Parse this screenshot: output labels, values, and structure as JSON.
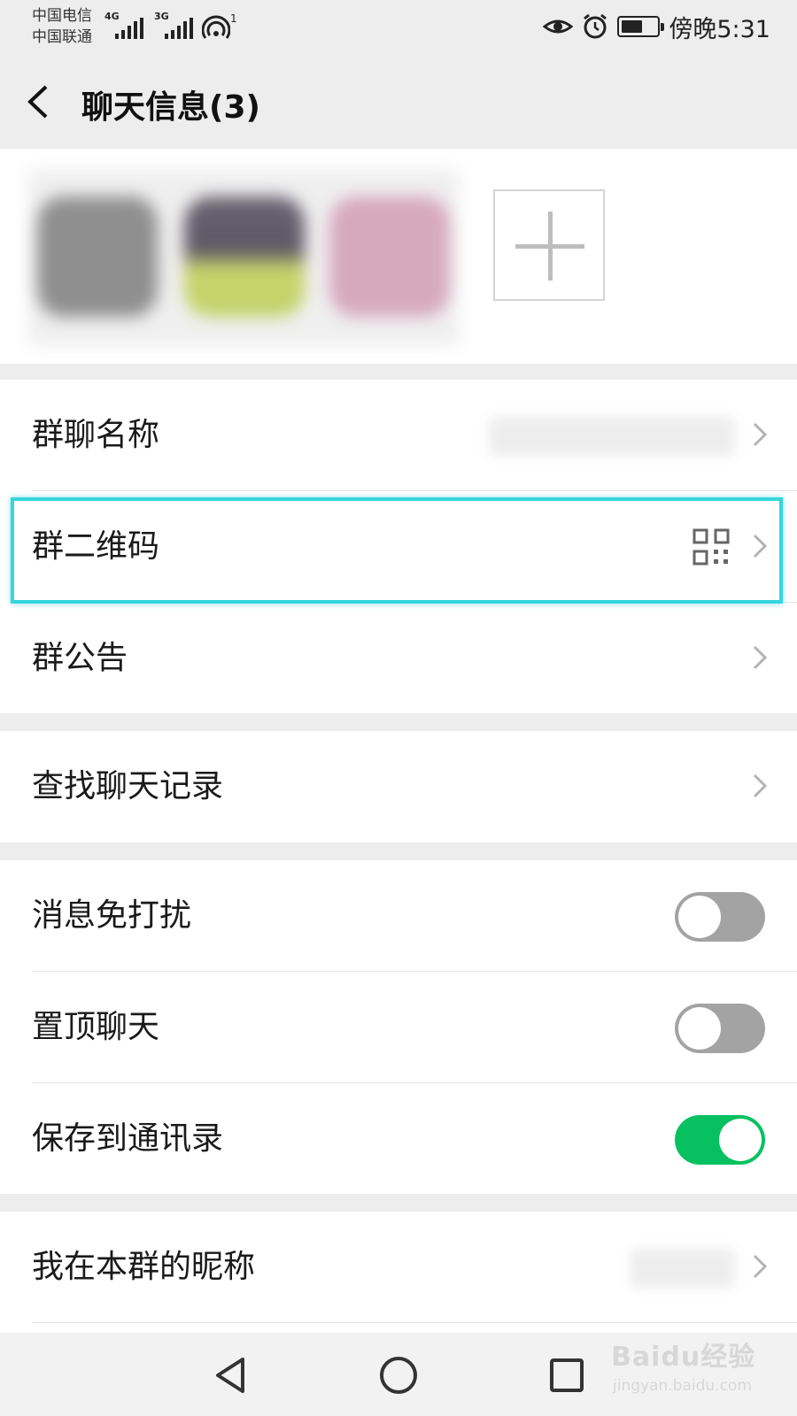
{
  "status_bar": {
    "carrier_1": "中国电信",
    "carrier_2": "中国联通",
    "signal_1_type": "4G",
    "signal_2_type": "3G",
    "hotspot_count": "1",
    "time": "傍晚5:31",
    "battery_level": 0.6,
    "icons": [
      "eye-icon",
      "alarm-icon",
      "battery-icon",
      "hotspot-icon"
    ]
  },
  "header": {
    "title": "聊天信息(3)",
    "back_icon": "chevron-left-icon"
  },
  "members": {
    "avatar_count": 3,
    "add_button_icon": "plus-icon"
  },
  "rows": {
    "group_name": {
      "label": "群聊名称"
    },
    "group_qrcode": {
      "label": "群二维码",
      "icon": "qr-code-icon"
    },
    "group_notice": {
      "label": "群公告"
    },
    "search_history": {
      "label": "查找聊天记录"
    },
    "mute": {
      "label": "消息免打扰",
      "on": false
    },
    "sticky": {
      "label": "置顶聊天",
      "on": false
    },
    "save_contacts": {
      "label": "保存到通讯录",
      "on": true
    },
    "my_nickname": {
      "label": "我在本群的昵称"
    }
  },
  "colors": {
    "toggle_on": "#07c160",
    "toggle_off": "#a3a3a3",
    "highlight": "#35d6de",
    "background": "#ededed"
  },
  "navbar": {
    "buttons": [
      "back-nav-icon",
      "home-nav-icon",
      "recents-nav-icon"
    ]
  },
  "watermark": {
    "brand": "Baidu经验",
    "url": "jingyan.baidu.com"
  }
}
